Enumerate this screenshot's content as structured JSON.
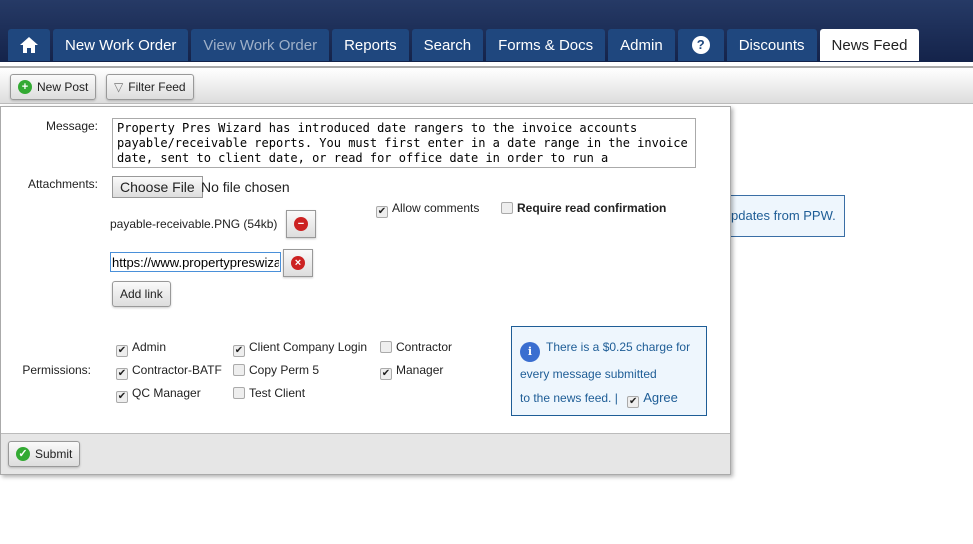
{
  "nav": {
    "tabs": [
      "New Work Order",
      "View Work Order",
      "Reports",
      "Search",
      "Forms & Docs",
      "Admin",
      "Discounts",
      "News Feed"
    ],
    "home_icon": "home-icon",
    "help_icon": "question-icon"
  },
  "toolbar": {
    "new_post": "New Post",
    "filter_feed": "Filter Feed"
  },
  "background": {
    "snippet": "pdates from PPW."
  },
  "form": {
    "message_label": "Message:",
    "message": "Property Pres Wizard has introduced date rangers to the invoice accounts payable/receivable reports. You must first enter in a date range in the invoice date, sent to client date, or read for office date in order to run a",
    "attachments_label": "Attachments:",
    "choose_file": "Choose File",
    "no_file": "No file chosen",
    "attachment": "payable-receivable.PNG (54kb)",
    "link_value": "https://www.propertypreswizard.com",
    "add_link": "Add link",
    "allow_comments": "Allow comments",
    "allow_comments_checked": true,
    "require_read": "Require read confirmation",
    "require_read_checked": false,
    "permissions_label": "Permissions:",
    "permissions": [
      {
        "label": "Admin",
        "checked": true
      },
      {
        "label": "Client Company Login",
        "checked": true
      },
      {
        "label": "Contractor",
        "checked": false
      },
      {
        "label": "Contractor-BATF",
        "checked": true
      },
      {
        "label": "Copy Perm 5",
        "checked": false
      },
      {
        "label": "Manager",
        "checked": true
      },
      {
        "label": "QC Manager",
        "checked": true
      },
      {
        "label": "Test Client",
        "checked": false
      }
    ],
    "info_line1": "There is a $0.25 charge for",
    "info_line2": "every message submitted",
    "info_line3": "to the news feed. |",
    "agree": "Agree",
    "agree_checked": true,
    "submit": "Submit"
  }
}
